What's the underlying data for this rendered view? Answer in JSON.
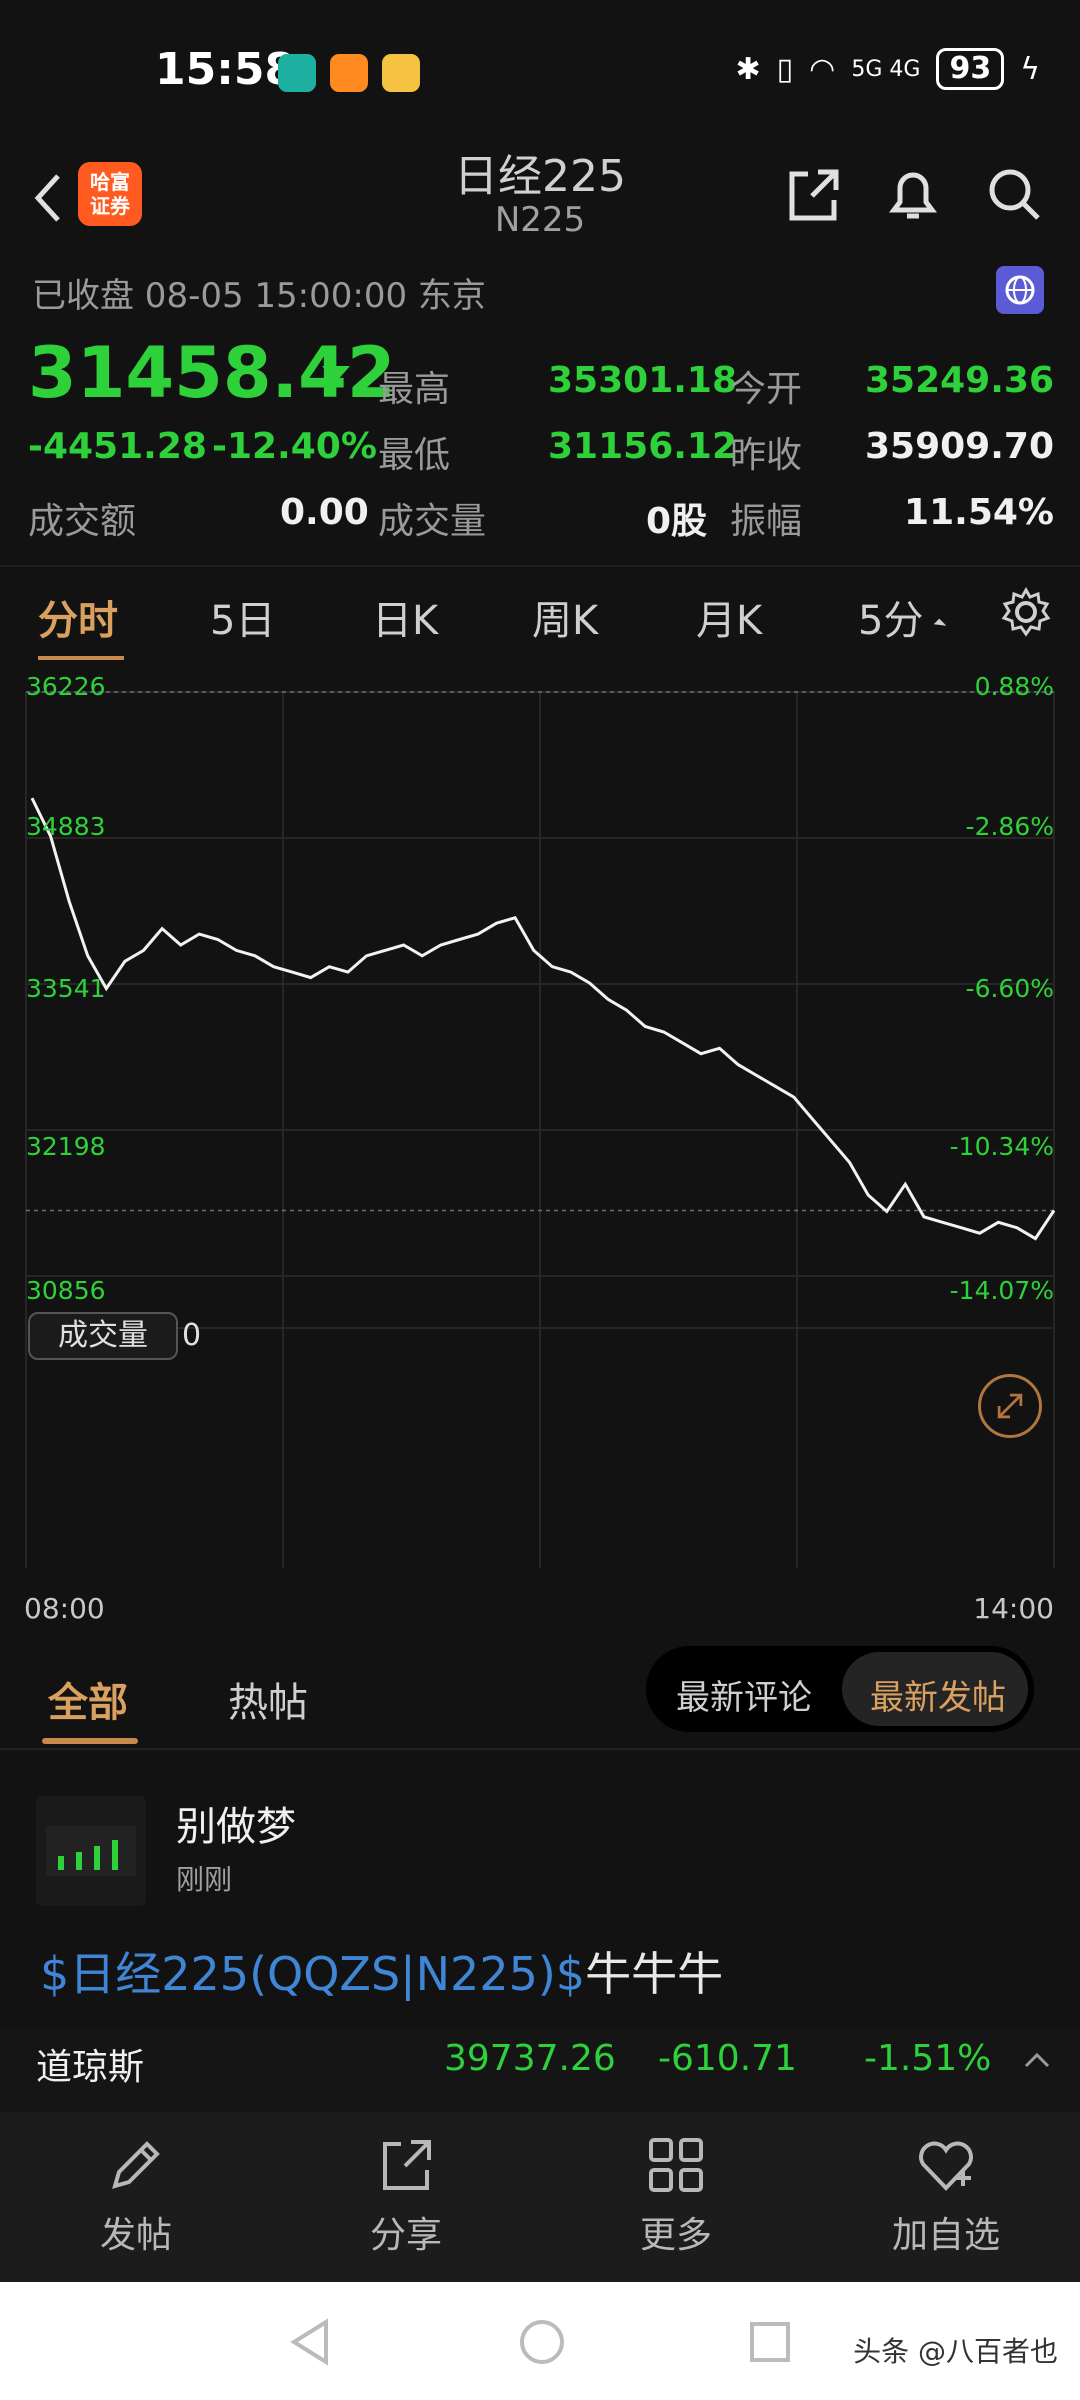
{
  "status_bar": {
    "time": "15:58",
    "network": "5G 4G",
    "battery": "93",
    "app_icons": [
      "app-badge-green",
      "video-app-icon",
      "weibo-icon"
    ]
  },
  "header": {
    "title": "日经225",
    "subtitle": "N225",
    "logo_text_1": "哈富",
    "logo_text_2": "证券",
    "icons": [
      "back-icon",
      "share-icon",
      "bell-icon",
      "search-icon"
    ]
  },
  "market_status": "已收盘 08-05 15:00:00 东京",
  "quote": {
    "price": "31458.42",
    "change": "-4451.28",
    "change_pct": "-12.40%",
    "high_label": "最高",
    "high": "35301.18",
    "open_label": "今开",
    "open": "35249.36",
    "low_label": "最低",
    "low": "31156.12",
    "prev_close_label": "昨收",
    "prev_close": "35909.70",
    "turnover_label": "成交额",
    "turnover": "0.00",
    "volume_label": "成交量",
    "volume": "0股",
    "amplitude_label": "振幅",
    "amplitude": "11.54%"
  },
  "chart_tabs": [
    "分时",
    "5日",
    "日K",
    "周K",
    "月K",
    "5分"
  ],
  "chart_data": {
    "type": "line",
    "y_axis_left": [
      "36226",
      "34883",
      "33541",
      "32198",
      "30856"
    ],
    "y_axis_right": [
      "0.88%",
      "-2.86%",
      "-6.60%",
      "-10.34%",
      "-14.07%"
    ],
    "x_labels": [
      "08:00",
      "14:00"
    ],
    "ylim": [
      30856,
      36226
    ],
    "series": [
      {
        "values": [
          35250,
          34900,
          34300,
          33800,
          33500,
          33750,
          33850,
          34050,
          33900,
          34000,
          33950,
          33850,
          33800,
          33700,
          33650,
          33600,
          33700,
          33650,
          33800,
          33850,
          33900,
          33800,
          33900,
          33950,
          34000,
          34100,
          34150,
          33850,
          33700,
          33650,
          33550,
          33400,
          33300,
          33150,
          33100,
          33000,
          32900,
          32950,
          32800,
          32700,
          32600,
          32500,
          32300,
          32100,
          31900,
          31600,
          31450,
          31700,
          31400,
          31350,
          31300,
          31250,
          31350,
          31300,
          31200,
          31458
        ]
      }
    ]
  },
  "volume": {
    "label": "成交量",
    "value": "0"
  },
  "feed_tabs": {
    "all": "全部",
    "hot": "热帖",
    "latest_comment": "最新评论",
    "latest_post": "最新发帖"
  },
  "post": {
    "author": "别做梦",
    "time": "刚刚",
    "link": "$日经225(QQZS|N225)$",
    "text": "牛牛牛"
  },
  "dow": {
    "name": "道琼斯",
    "value": "39737.26",
    "change": "-610.71",
    "change_pct": "-1.51%"
  },
  "bottom_nav": [
    {
      "label": "发帖"
    },
    {
      "label": "分享"
    },
    {
      "label": "更多"
    },
    {
      "label": "加自选"
    }
  ],
  "watermark": "头条 @八百者也"
}
